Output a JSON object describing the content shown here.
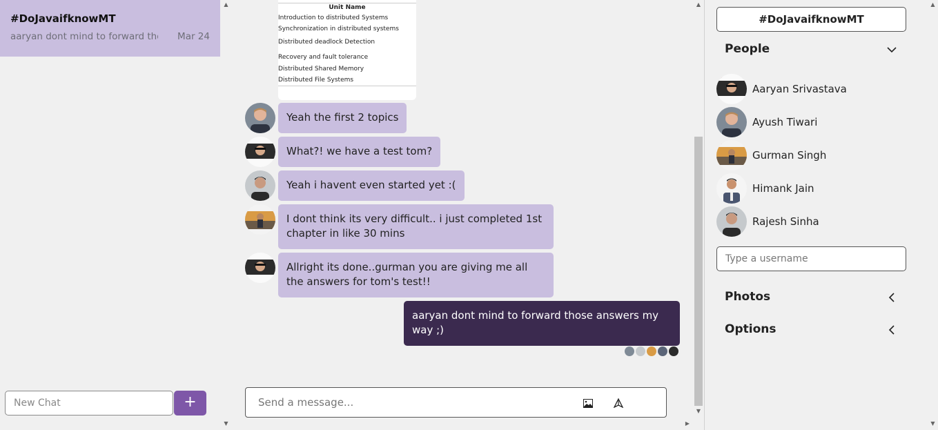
{
  "sidebar": {
    "chat": {
      "title": "#DoJavaifknowMT",
      "preview": "aaryan dont mind to forward those answers my way ;)",
      "date": "Mar 24"
    },
    "new_chat_placeholder": "New Chat",
    "new_chat_button": "+"
  },
  "feed": {
    "attachment": {
      "header": "Unit Name",
      "lines": [
        "Introduction to distributed Systems",
        "Synchronization in distributed systems",
        "Distributed deadlock Detection",
        "Recovery and fault tolerance",
        "Distributed Shared Memory",
        "Distributed File Systems"
      ]
    },
    "messages": [
      {
        "author": "Ayush Tiwari",
        "text": "Yeah the first 2 topics"
      },
      {
        "author": "Aaryan Srivastava",
        "text": "What?! we have a test tom?"
      },
      {
        "author": "Rajesh Sinha",
        "text": "Yeah i havent even started yet :("
      },
      {
        "author": "Gurman Singh",
        "text": "I dont think its very difficult.. i just completed 1st chapter in like 30 mins"
      },
      {
        "author": "Aaryan Srivastava",
        "text": "Allright its done..gurman you are giving me all the answers for tom's test!!"
      },
      {
        "author": "me",
        "text": "aaryan dont mind to forward those answers my way ;)"
      }
    ],
    "compose_placeholder": "Send a message..."
  },
  "details": {
    "channel_title": "#DoJavaifknowMT",
    "people_label": "People",
    "people": [
      {
        "name": "Aaryan Srivastava",
        "status_color": "#e53935"
      },
      {
        "name": "Ayush Tiwari",
        "status_color": "#e53935"
      },
      {
        "name": "Gurman Singh",
        "status_color": "#e53935"
      },
      {
        "name": "Himank Jain",
        "status_color": "#43a047"
      },
      {
        "name": "Rajesh Sinha",
        "status_color": "#e53935"
      }
    ],
    "username_placeholder": "Type a username",
    "photos_label": "Photos",
    "options_label": "Options"
  },
  "colors": {
    "accent": "#7e57a8",
    "bubble": "#c9bedf",
    "my_bubble": "#3b2a4f"
  }
}
